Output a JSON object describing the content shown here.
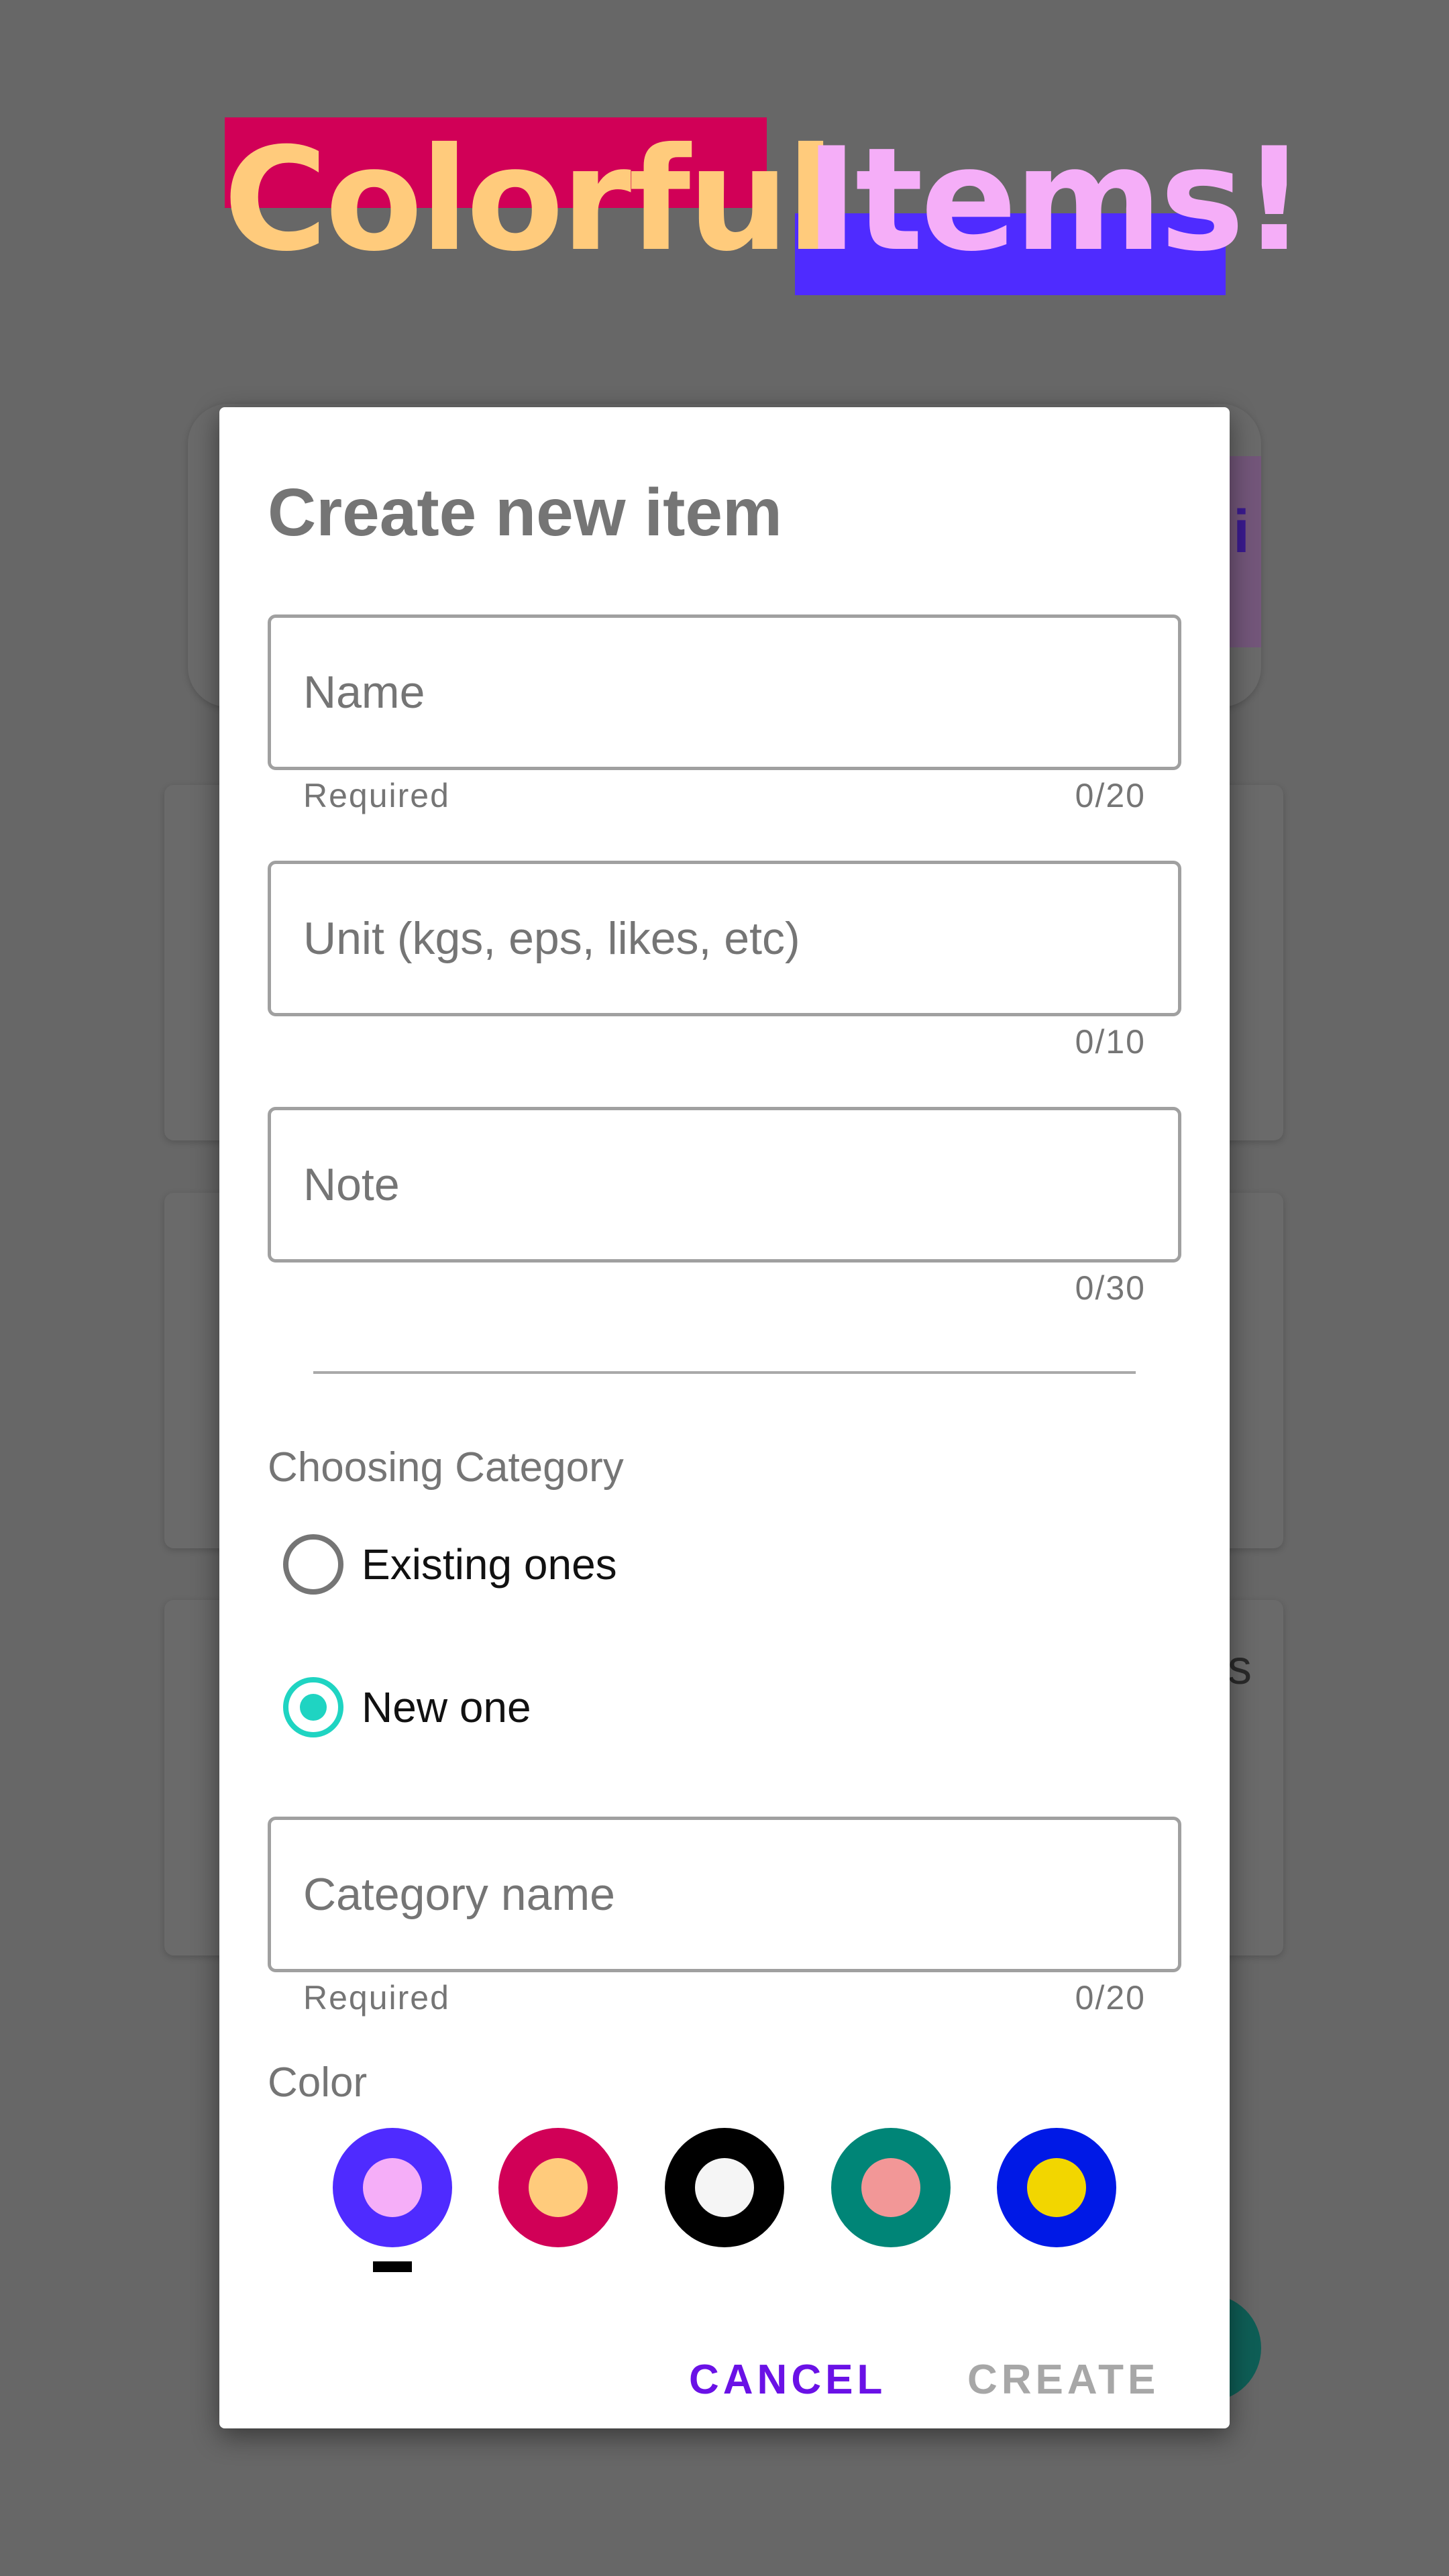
{
  "app_title": {
    "word1": "Colorful",
    "word2": "Items!"
  },
  "background": {
    "peek_char_1": "i",
    "peek_char_2": "s"
  },
  "dialog": {
    "title": "Create new item",
    "name_field": {
      "placeholder": "Name",
      "value": "",
      "helper": "Required",
      "counter": "0/20"
    },
    "unit_field": {
      "placeholder": "Unit (kgs, eps, likes, etc)",
      "value": "",
      "counter": "0/10"
    },
    "note_field": {
      "placeholder": "Note",
      "value": "",
      "counter": "0/30"
    },
    "category_section": {
      "label": "Choosing Category",
      "options": [
        {
          "label": "Existing ones",
          "checked": false
        },
        {
          "label": "New one",
          "checked": true
        }
      ]
    },
    "category_name_field": {
      "placeholder": "Category name",
      "value": "",
      "helper": "Required",
      "counter": "0/20"
    },
    "color_section": {
      "label": "Color",
      "swatches": [
        {
          "outer": "#4f2bff",
          "inner": "#f5aef8",
          "selected": true
        },
        {
          "outer": "#d10057",
          "inner": "#ffcb7c",
          "selected": false
        },
        {
          "outer": "#000000",
          "inner": "#f5f5f5",
          "selected": false
        },
        {
          "outer": "#008577",
          "inner": "#f29797",
          "selected": false
        },
        {
          "outer": "#0019e6",
          "inner": "#f2d600",
          "selected": false
        }
      ]
    },
    "actions": {
      "cancel": "CANCEL",
      "create": "CREATE"
    }
  },
  "colors": {
    "scrim": "#676767",
    "accent_teal": "#1fd4c2",
    "accent_purple": "#6a11e6"
  }
}
